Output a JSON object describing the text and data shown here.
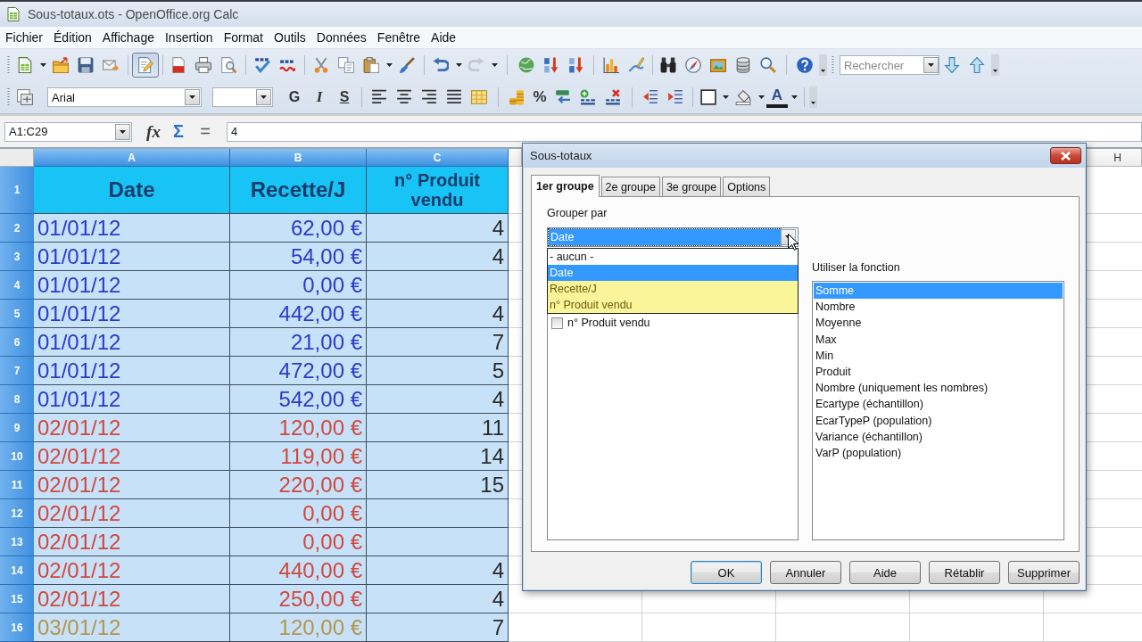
{
  "window": {
    "title": "Sous-totaux.ots - OpenOffice.org Calc"
  },
  "menu_bar": [
    "Fichier",
    "Édition",
    "Affichage",
    "Insertion",
    "Format",
    "Outils",
    "Données",
    "Fenêtre",
    "Aide"
  ],
  "standard_toolbar": {
    "edit_file_button": {
      "pressed": true
    },
    "redo_button": {
      "disabled": true
    },
    "search_field": {
      "placeholder": "Rechercher"
    }
  },
  "formatting_toolbar": {
    "font_name": "Arial",
    "style_buttons": [
      "G",
      "I",
      "S"
    ],
    "percent_button": "%",
    "font_color_button": "A"
  },
  "formula_bar": {
    "name_box": "A1:C29",
    "function_wizard_button": "fx",
    "sum_button": "Σ",
    "formula_button": "=",
    "input": "4"
  },
  "sheet": {
    "columns": [
      {
        "label": "A",
        "selected": true
      },
      {
        "label": "B",
        "selected": true
      },
      {
        "label": "C",
        "selected": true
      },
      {
        "label": "H",
        "selected": false
      }
    ],
    "header_row": {
      "row_number": "1",
      "selected": true,
      "cells": [
        "Date",
        "Recette/J",
        "n° Produit vendu"
      ]
    },
    "rows": [
      {
        "row_number": "2",
        "selected": true,
        "date": "01/01/12",
        "recette_j": "62,00 €",
        "n_produit_vendu": "4",
        "color": "#2a3ac8"
      },
      {
        "row_number": "3",
        "selected": true,
        "date": "01/01/12",
        "recette_j": "54,00 €",
        "n_produit_vendu": "4",
        "color": "#2a3ac8"
      },
      {
        "row_number": "4",
        "selected": true,
        "date": "01/01/12",
        "recette_j": "0,00 €",
        "color": "#2a3ac8"
      },
      {
        "row_number": "5",
        "selected": true,
        "date": "01/01/12",
        "recette_j": "442,00 €",
        "n_produit_vendu": "4",
        "color": "#2a3ac8"
      },
      {
        "row_number": "6",
        "selected": true,
        "date": "01/01/12",
        "recette_j": "21,00 €",
        "n_produit_vendu": "7",
        "color": "#2a3ac8"
      },
      {
        "row_number": "7",
        "selected": true,
        "date": "01/01/12",
        "recette_j": "472,00 €",
        "n_produit_vendu": "5",
        "color": "#2a3ac8"
      },
      {
        "row_number": "8",
        "selected": true,
        "date": "01/01/12",
        "recette_j": "542,00 €",
        "n_produit_vendu": "4",
        "color": "#2a3ac8"
      },
      {
        "row_number": "9",
        "selected": true,
        "date": "02/01/12",
        "recette_j": "120,00 €",
        "n_produit_vendu": "11",
        "color": "#d0483e"
      },
      {
        "row_number": "10",
        "selected": true,
        "date": "02/01/12",
        "recette_j": "119,00 €",
        "n_produit_vendu": "14",
        "color": "#d0483e"
      },
      {
        "row_number": "11",
        "selected": true,
        "date": "02/01/12",
        "recette_j": "220,00 €",
        "n_produit_vendu": "15",
        "color": "#d0483e"
      },
      {
        "row_number": "12",
        "selected": true,
        "date": "02/01/12",
        "recette_j": "0,00 €",
        "color": "#d0483e"
      },
      {
        "row_number": "13",
        "selected": true,
        "date": "02/01/12",
        "recette_j": "0,00 €",
        "color": "#d0483e"
      },
      {
        "row_number": "14",
        "selected": true,
        "date": "02/01/12",
        "recette_j": "440,00 €",
        "n_produit_vendu": "4",
        "color": "#d0483e"
      },
      {
        "row_number": "15",
        "selected": true,
        "date": "02/01/12",
        "recette_j": "250,00 €",
        "n_produit_vendu": "4",
        "color": "#d0483e"
      },
      {
        "row_number": "16",
        "selected": true,
        "date": "03/01/12",
        "recette_j": "120,00 €",
        "n_produit_vendu": "7",
        "color": "#b5944c"
      }
    ]
  },
  "dialog": {
    "title": "Sous-totaux",
    "tabs": [
      {
        "label": "1er groupe",
        "selected": true
      },
      {
        "label": "2e groupe",
        "selected": false
      },
      {
        "label": "3e groupe",
        "selected": false
      },
      {
        "label": "Options",
        "selected": false
      }
    ],
    "group_by": {
      "label": "Grouper par",
      "value": "Date",
      "focused": true,
      "options": [
        {
          "label": "- aucun -",
          "selected": false,
          "highlighted": false
        },
        {
          "label": "Date",
          "selected": true,
          "highlighted": false
        },
        {
          "label": "Recette/J",
          "selected": false,
          "highlighted": true
        },
        {
          "label": "n° Produit vendu",
          "selected": false,
          "highlighted": true
        }
      ]
    },
    "subtotal_columns": [
      {
        "label": "n° Produit vendu",
        "checked": false
      }
    ],
    "function": {
      "label": "Utiliser la fonction",
      "items": [
        {
          "label": "Somme",
          "selected": true
        },
        {
          "label": "Nombre",
          "selected": false
        },
        {
          "label": "Moyenne",
          "selected": false
        },
        {
          "label": "Max",
          "selected": false
        },
        {
          "label": "Min",
          "selected": false
        },
        {
          "label": "Produit",
          "selected": false
        },
        {
          "label": "Nombre (uniquement les nombres)",
          "selected": false
        },
        {
          "label": "Ecartype (échantillon)",
          "selected": false
        },
        {
          "label": "EcarTypeP (population)",
          "selected": false
        },
        {
          "label": "Variance (échantillon)",
          "selected": false
        },
        {
          "label": "VarP (population)",
          "selected": false
        }
      ]
    },
    "buttons": [
      {
        "label": "OK",
        "default": true
      },
      {
        "label": "Annuler",
        "default": false
      },
      {
        "label": "Aide",
        "default": false
      },
      {
        "label": "Rétablir",
        "default": false
      },
      {
        "label": "Supprimer",
        "default": false
      }
    ]
  }
}
